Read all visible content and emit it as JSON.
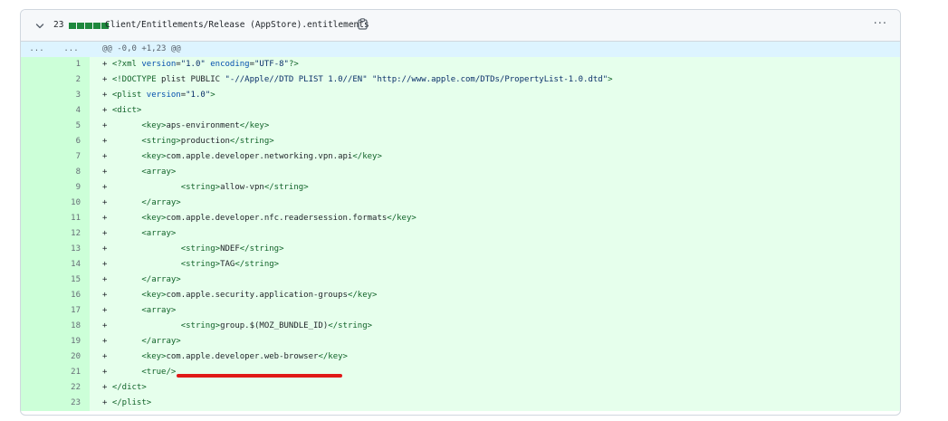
{
  "header": {
    "changes": "23",
    "path": "Client/Entitlements/Release (AppStore).entitlements",
    "more": "···"
  },
  "hunk": {
    "old_num": "...",
    "new_num": "...",
    "text": "@@ -0,0 +1,23 @@"
  },
  "lines": [
    {
      "n": "1",
      "parts": [
        [
          "t",
          "+ "
        ],
        [
          "tag",
          "<?xml "
        ],
        [
          "attr",
          "version"
        ],
        [
          "t",
          "="
        ],
        [
          "str",
          "\"1.0\""
        ],
        [
          "t",
          " "
        ],
        [
          "attr",
          "encoding"
        ],
        [
          "t",
          "="
        ],
        [
          "str",
          "\"UTF-8\""
        ],
        [
          "tag",
          "?>"
        ]
      ]
    },
    {
      "n": "2",
      "parts": [
        [
          "t",
          "+ "
        ],
        [
          "tag",
          "<!DOCTYPE "
        ],
        [
          "t",
          "plist PUBLIC "
        ],
        [
          "str",
          "\"-//Apple//DTD PLIST 1.0//EN\""
        ],
        [
          "t",
          " "
        ],
        [
          "str",
          "\"http://www.apple.com/DTDs/PropertyList-1.0.dtd\""
        ],
        [
          "tag",
          ">"
        ]
      ]
    },
    {
      "n": "3",
      "parts": [
        [
          "t",
          "+ "
        ],
        [
          "tag",
          "<plist "
        ],
        [
          "attr",
          "version"
        ],
        [
          "t",
          "="
        ],
        [
          "str",
          "\"1.0\""
        ],
        [
          "tag",
          ">"
        ]
      ]
    },
    {
      "n": "4",
      "parts": [
        [
          "t",
          "+ "
        ],
        [
          "tag",
          "<dict>"
        ]
      ]
    },
    {
      "n": "5",
      "parts": [
        [
          "t",
          "+       "
        ],
        [
          "tag",
          "<key>"
        ],
        [
          "t",
          "aps-environment"
        ],
        [
          "tag",
          "</key>"
        ]
      ]
    },
    {
      "n": "6",
      "parts": [
        [
          "t",
          "+       "
        ],
        [
          "tag",
          "<string>"
        ],
        [
          "t",
          "production"
        ],
        [
          "tag",
          "</string>"
        ]
      ]
    },
    {
      "n": "7",
      "parts": [
        [
          "t",
          "+       "
        ],
        [
          "tag",
          "<key>"
        ],
        [
          "t",
          "com.apple.developer.networking.vpn.api"
        ],
        [
          "tag",
          "</key>"
        ]
      ]
    },
    {
      "n": "8",
      "parts": [
        [
          "t",
          "+       "
        ],
        [
          "tag",
          "<array>"
        ]
      ]
    },
    {
      "n": "9",
      "parts": [
        [
          "t",
          "+               "
        ],
        [
          "tag",
          "<string>"
        ],
        [
          "t",
          "allow-vpn"
        ],
        [
          "tag",
          "</string>"
        ]
      ]
    },
    {
      "n": "10",
      "parts": [
        [
          "t",
          "+       "
        ],
        [
          "tag",
          "</array>"
        ]
      ]
    },
    {
      "n": "11",
      "parts": [
        [
          "t",
          "+       "
        ],
        [
          "tag",
          "<key>"
        ],
        [
          "t",
          "com.apple.developer.nfc.readersession.formats"
        ],
        [
          "tag",
          "</key>"
        ]
      ]
    },
    {
      "n": "12",
      "parts": [
        [
          "t",
          "+       "
        ],
        [
          "tag",
          "<array>"
        ]
      ]
    },
    {
      "n": "13",
      "parts": [
        [
          "t",
          "+               "
        ],
        [
          "tag",
          "<string>"
        ],
        [
          "t",
          "NDEF"
        ],
        [
          "tag",
          "</string>"
        ]
      ]
    },
    {
      "n": "14",
      "parts": [
        [
          "t",
          "+               "
        ],
        [
          "tag",
          "<string>"
        ],
        [
          "t",
          "TAG"
        ],
        [
          "tag",
          "</string>"
        ]
      ]
    },
    {
      "n": "15",
      "parts": [
        [
          "t",
          "+       "
        ],
        [
          "tag",
          "</array>"
        ]
      ]
    },
    {
      "n": "16",
      "parts": [
        [
          "t",
          "+       "
        ],
        [
          "tag",
          "<key>"
        ],
        [
          "t",
          "com.apple.security.application-groups"
        ],
        [
          "tag",
          "</key>"
        ]
      ]
    },
    {
      "n": "17",
      "parts": [
        [
          "t",
          "+       "
        ],
        [
          "tag",
          "<array>"
        ]
      ]
    },
    {
      "n": "18",
      "parts": [
        [
          "t",
          "+               "
        ],
        [
          "tag",
          "<string>"
        ],
        [
          "t",
          "group.$(MOZ_BUNDLE_ID)"
        ],
        [
          "tag",
          "</string>"
        ]
      ]
    },
    {
      "n": "19",
      "parts": [
        [
          "t",
          "+       "
        ],
        [
          "tag",
          "</array>"
        ]
      ]
    },
    {
      "n": "20",
      "parts": [
        [
          "t",
          "+       "
        ],
        [
          "tag",
          "<key>"
        ],
        [
          "t",
          "com.apple.developer.web-browser"
        ],
        [
          "tag",
          "</key>"
        ]
      ]
    },
    {
      "n": "21",
      "parts": [
        [
          "t",
          "+       "
        ],
        [
          "tag",
          "<true/>"
        ]
      ]
    },
    {
      "n": "22",
      "parts": [
        [
          "t",
          "+ "
        ],
        [
          "tag",
          "</dict>"
        ]
      ]
    },
    {
      "n": "23",
      "parts": [
        [
          "t",
          "+ "
        ],
        [
          "tag",
          "</plist>"
        ]
      ]
    }
  ],
  "colors": {
    "added_line_bg": "#e6ffec",
    "added_num_bg": "#ccffd8",
    "hunk_bg": "#ddf4ff",
    "diffstat_green": "#1f883d",
    "annotation_red": "#e01818"
  },
  "icons": {
    "collapse": "chevron-down-icon",
    "copy": "copy-icon",
    "more": "kebab-horizontal-icon"
  }
}
